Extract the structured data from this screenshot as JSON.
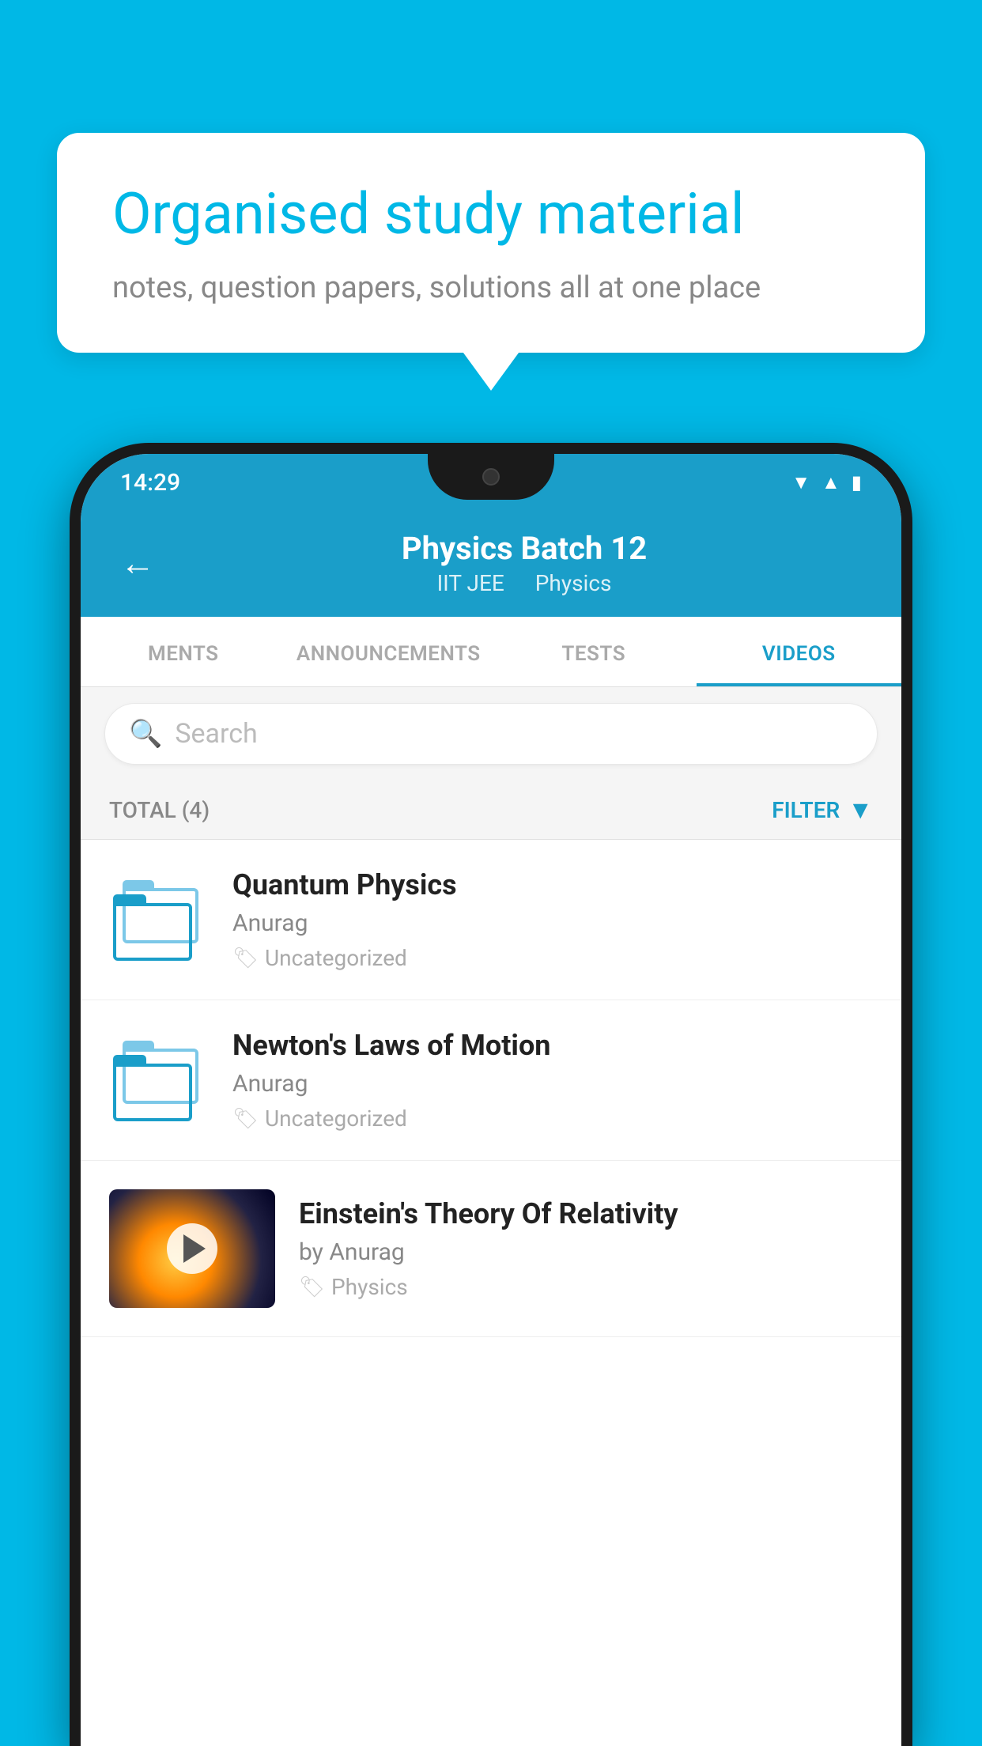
{
  "background_color": "#00b8e6",
  "bubble": {
    "title": "Organised study material",
    "subtitle": "notes, question papers, solutions all at one place"
  },
  "phone": {
    "status_bar": {
      "time": "14:29",
      "icons": [
        "wifi",
        "signal",
        "battery"
      ]
    },
    "header": {
      "back_label": "←",
      "title": "Physics Batch 12",
      "subtitle_iit": "IIT JEE",
      "subtitle_physics": "Physics"
    },
    "tabs": [
      {
        "label": "MENTS",
        "active": false
      },
      {
        "label": "ANNOUNCEMENTS",
        "active": false
      },
      {
        "label": "TESTS",
        "active": false
      },
      {
        "label": "VIDEOS",
        "active": true
      }
    ],
    "search": {
      "placeholder": "Search"
    },
    "filter_bar": {
      "total_label": "TOTAL (4)",
      "filter_label": "FILTER"
    },
    "videos": [
      {
        "title": "Quantum Physics",
        "author": "Anurag",
        "tag": "Uncategorized",
        "has_thumb": false
      },
      {
        "title": "Newton's Laws of Motion",
        "author": "Anurag",
        "tag": "Uncategorized",
        "has_thumb": false
      },
      {
        "title": "Einstein's Theory Of Relativity",
        "author": "by Anurag",
        "tag": "Physics",
        "has_thumb": true
      }
    ]
  }
}
